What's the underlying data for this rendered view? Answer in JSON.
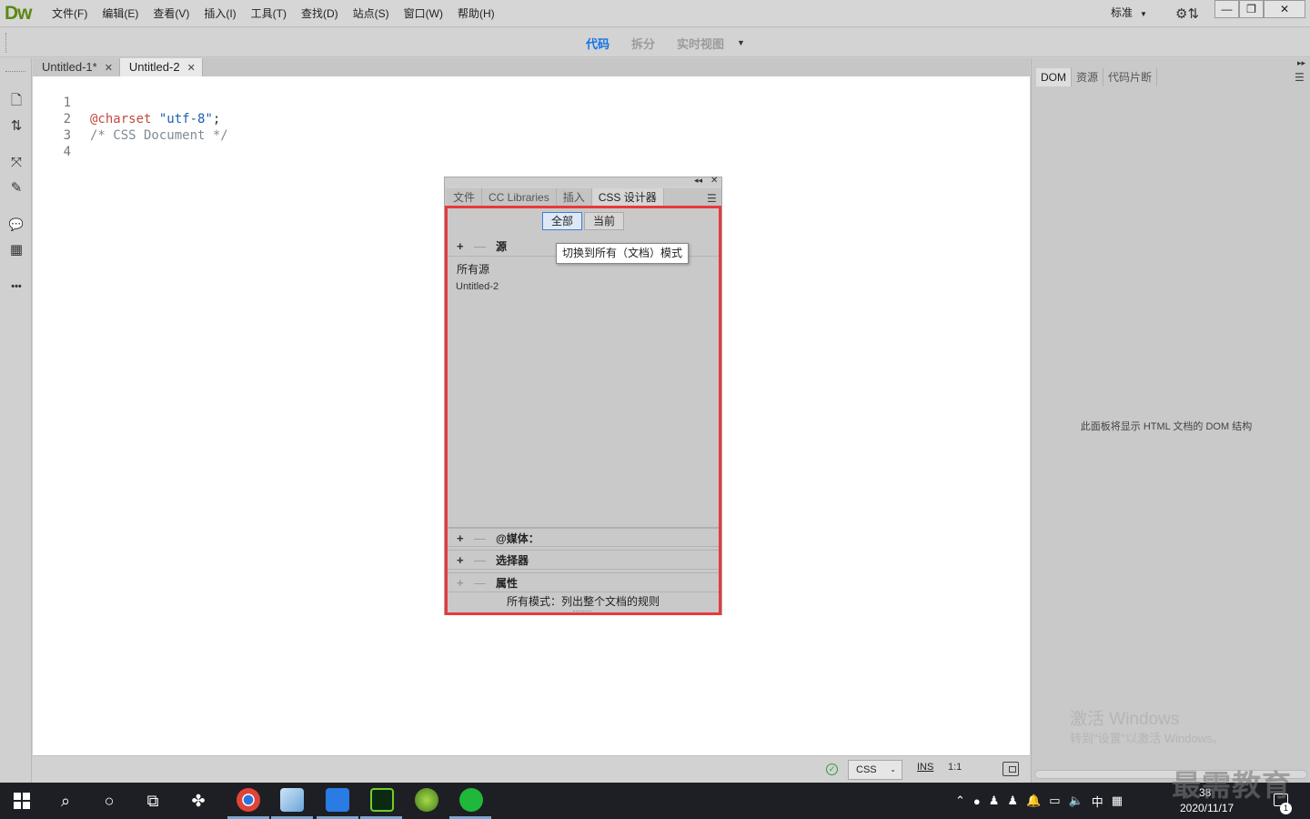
{
  "app": {
    "logo": "Dw",
    "menu": [
      "文件(F)",
      "编辑(E)",
      "查看(V)",
      "插入(I)",
      "工具(T)",
      "查找(D)",
      "站点(S)",
      "窗口(W)",
      "帮助(H)"
    ],
    "workspace": "标准",
    "window_buttons": {
      "min": "—",
      "max": "❐",
      "close": "✕"
    }
  },
  "view_switch": {
    "code": "代码",
    "split": "拆分",
    "live": "实时视图",
    "active": "code"
  },
  "doc_tabs": [
    {
      "label": "Untitled-1*",
      "active": false
    },
    {
      "label": "Untitled-2",
      "active": true
    }
  ],
  "editor": {
    "lines": [
      {
        "num": "1",
        "at": "@charset",
        "sp": " ",
        "str": "\"utf-8\"",
        "pun": ";",
        "com": ""
      },
      {
        "num": "2",
        "at": "",
        "sp": "",
        "str": "",
        "pun": "",
        "com": "/* CSS Document */"
      },
      {
        "num": "3",
        "at": "",
        "sp": "",
        "str": "",
        "pun": "",
        "com": ""
      },
      {
        "num": "4",
        "at": "",
        "sp": "",
        "str": "",
        "pun": "",
        "com": ""
      }
    ]
  },
  "left_toolbar": {
    "icons": [
      "file-icon",
      "sort-icon",
      "expand-icon",
      "brush-icon",
      "comment-icon",
      "format-icon",
      "more-icon"
    ],
    "glyphs": [
      "🗋",
      "⇅",
      "⤧",
      "✎",
      "💬",
      "▦",
      "•••"
    ]
  },
  "css_panel": {
    "tabs": [
      "文件",
      "CC Libraries",
      "插入",
      "CSS 设计器"
    ],
    "active_tab": "CSS 设计器",
    "modes": [
      "全部",
      "当前"
    ],
    "active_mode": "全部",
    "sources_title": "源",
    "tooltip": "切换到所有（文档）模式",
    "sources": [
      "所有源",
      "Untitled-2"
    ],
    "media_title": "@媒体：",
    "selectors_title": "选择器",
    "properties_title": "属性",
    "mode_description": "所有模式：列出整个文档的规则",
    "highlight_color": "#e8393b"
  },
  "right_panel": {
    "tabs": [
      "DOM",
      "资源",
      "代码片断"
    ],
    "active_tab": "DOM",
    "empty_message": "此面板将显示 HTML 文档的 DOM 结构",
    "activate_title": "激活 Windows",
    "activate_hint": "转到\"设置\"以激活 Windows。"
  },
  "status_bar": {
    "language": "CSS",
    "ins_mode": "INS",
    "cursor": "1:1"
  },
  "taskbar": {
    "time": "38",
    "date": "2020/11/17",
    "ime": "中",
    "notification_count": "1",
    "watermark": "最需教育"
  }
}
